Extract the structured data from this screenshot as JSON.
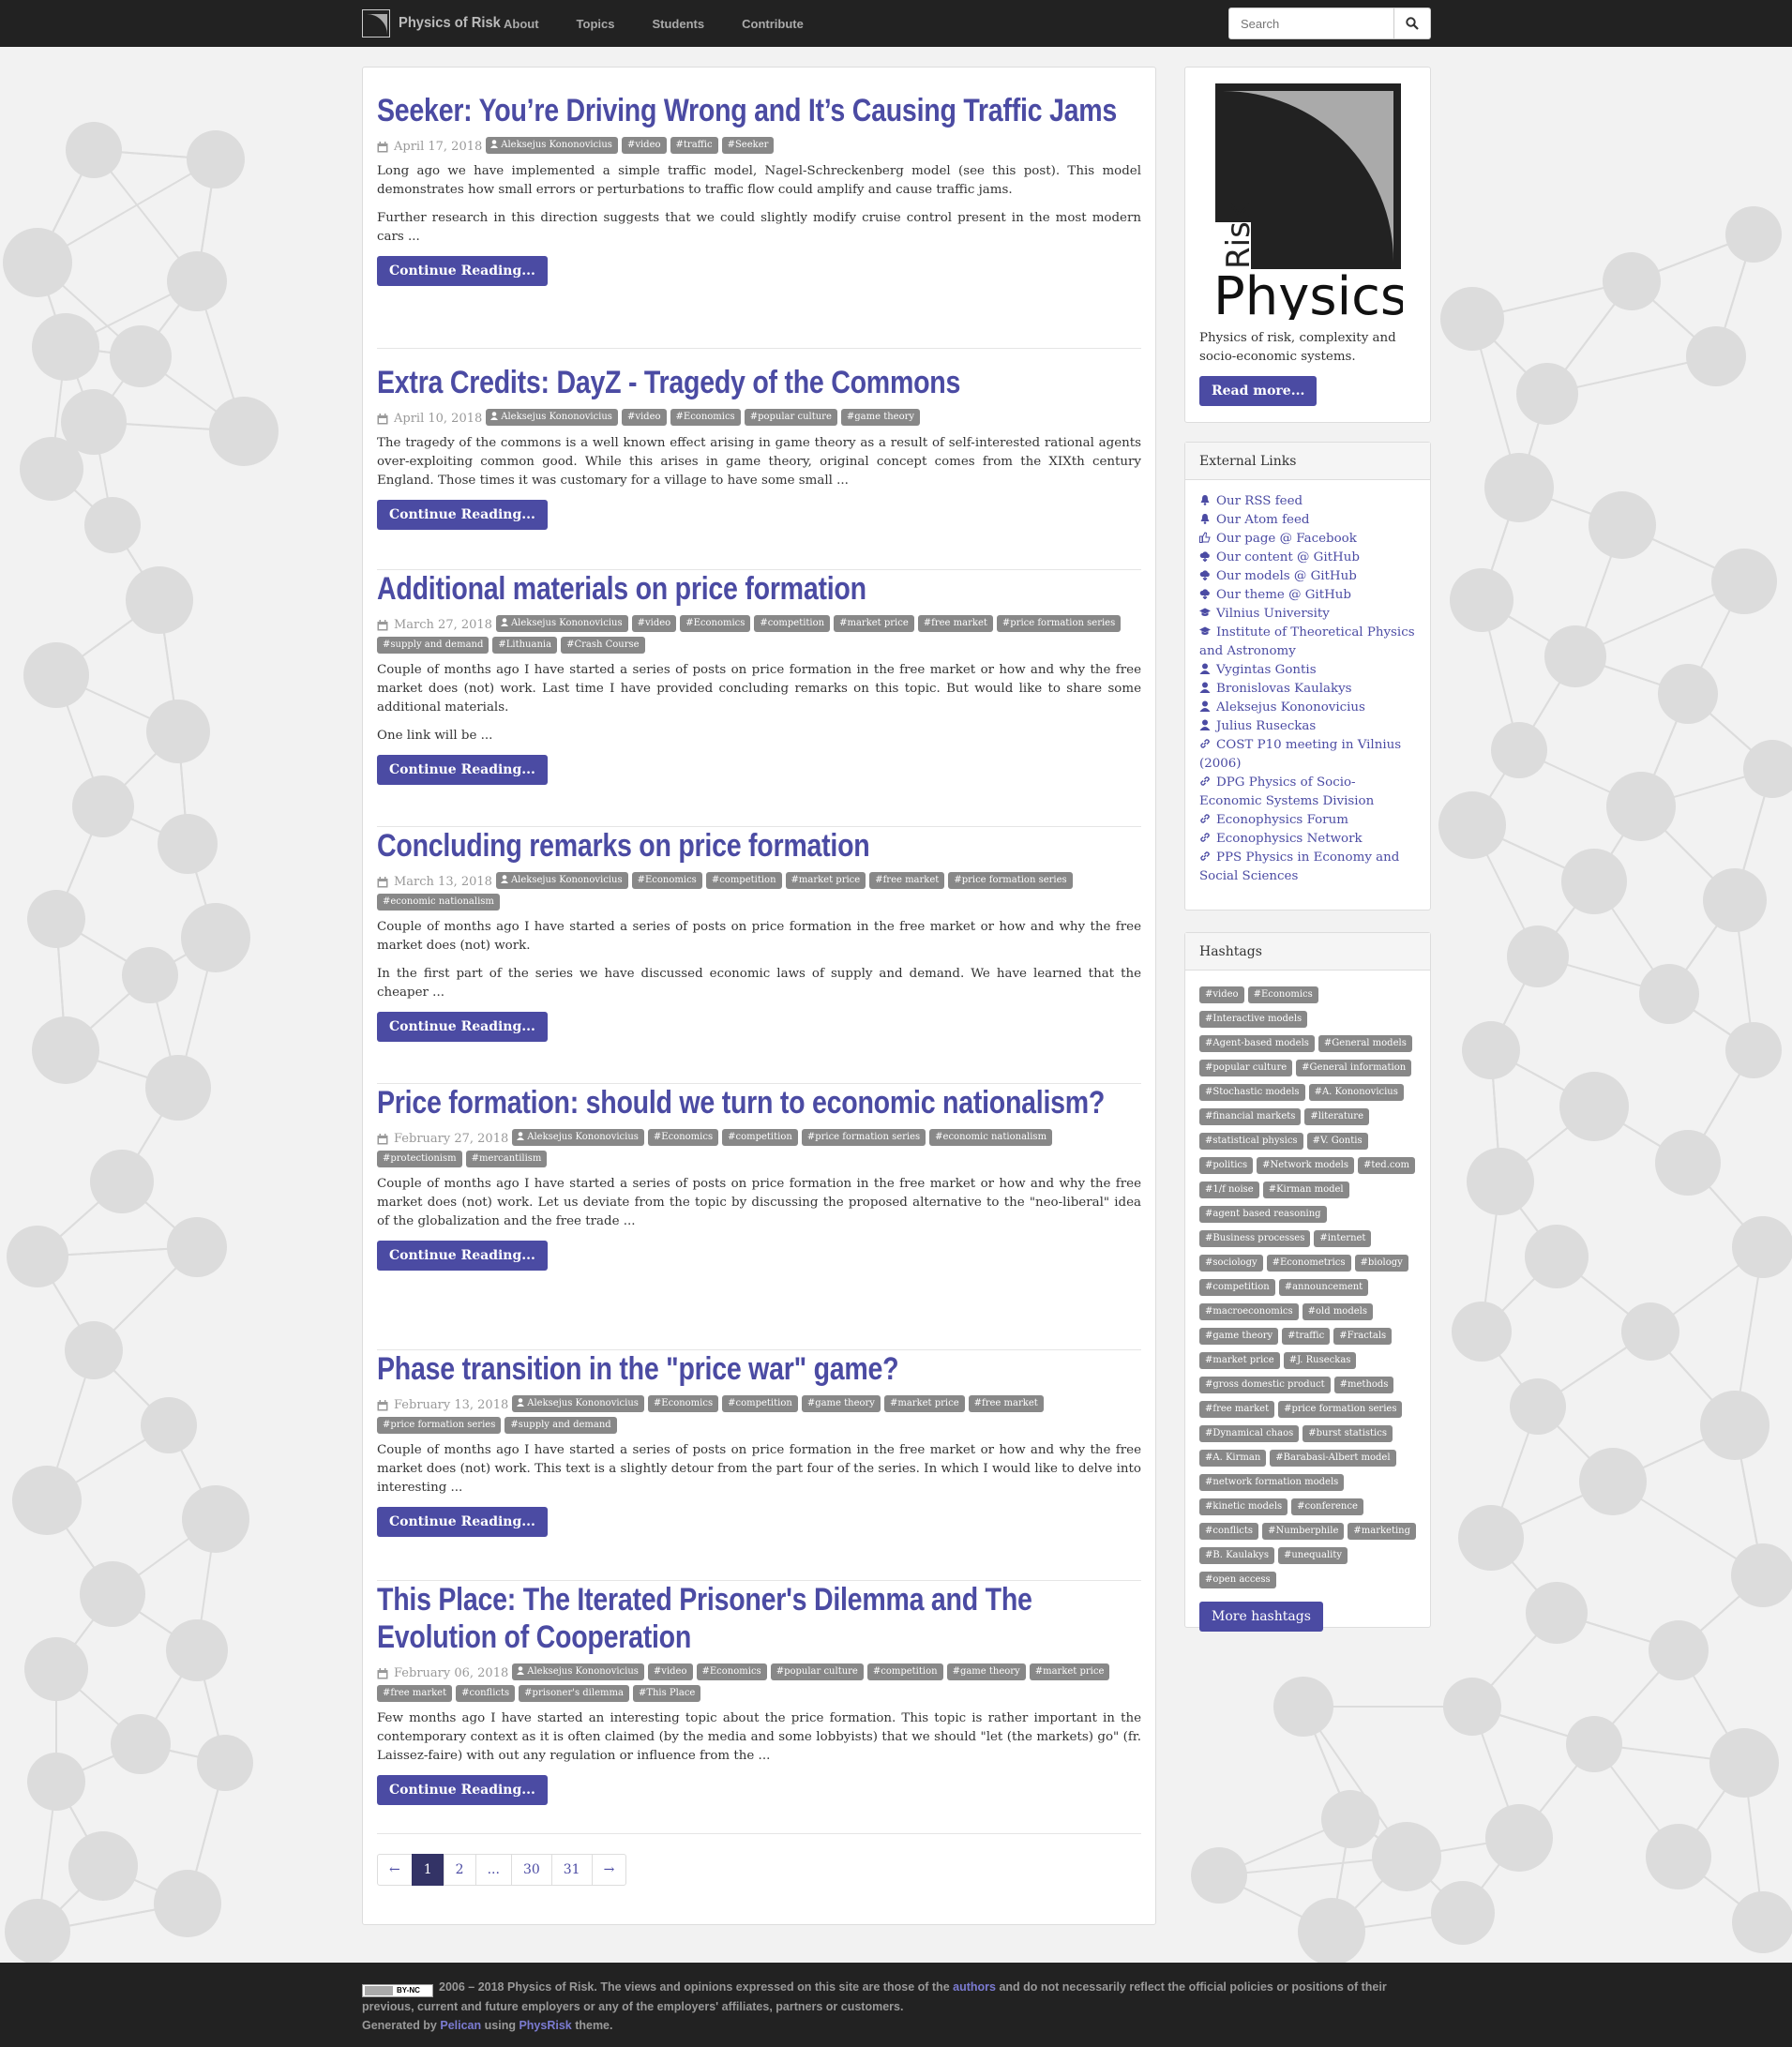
{
  "navbar": {
    "brand": "Physics of Risk",
    "links": [
      "About",
      "Topics",
      "Students",
      "Contribute"
    ],
    "search_placeholder": "Search"
  },
  "posts": [
    {
      "title": "Seeker: You’re Driving Wrong and It’s Causing Traffic Jams",
      "date": "April 17, 2018",
      "author": "Aleksejus Kononovicius",
      "tags": [
        "#video",
        "#traffic",
        "#Seeker"
      ],
      "paragraphs": [
        "Long ago we have implemented a simple traffic model, Nagel-Schreckenberg model (see this post). This model demonstrates how small errors or perturbations to traffic flow could amplify and cause traffic jams.",
        "Further research in this direction suggests that we could slightly modify cruise control present in the most modern cars ..."
      ],
      "button": "Continue Reading..."
    },
    {
      "title": "Extra Credits: DayZ - Tragedy of the Commons",
      "date": "April 10, 2018",
      "author": "Aleksejus Kononovicius",
      "tags": [
        "#video",
        "#Economics",
        "#popular culture",
        "#game theory"
      ],
      "paragraphs": [
        "The tragedy of the commons is a well known effect arising in game theory as a result of self-interested rational agents over-exploiting common good. While this arises in game theory, original concept comes from the XIXth century England. Those times it was customary for a village to have some small ..."
      ],
      "button": "Continue Reading..."
    },
    {
      "title": "Additional materials on price formation",
      "date": "March 27, 2018",
      "author": "Aleksejus Kononovicius",
      "tags": [
        "#video",
        "#Economics",
        "#competition",
        "#market price",
        "#free market",
        "#price formation series",
        "#supply and demand",
        "#Lithuania",
        "#Crash Course"
      ],
      "paragraphs": [
        "Couple of months ago I have started a series of posts on price formation in the free market or how and why the free market does (not) work. Last time I have provided concluding remarks on this topic. But would like to share some additional materials.",
        "One link will be ..."
      ],
      "button": "Continue Reading..."
    },
    {
      "title": "Concluding remarks on price formation",
      "date": "March 13, 2018",
      "author": "Aleksejus Kononovicius",
      "tags": [
        "#Economics",
        "#competition",
        "#market price",
        "#free market",
        "#price formation series",
        "#economic nationalism"
      ],
      "paragraphs": [
        "Couple of months ago I have started a series of posts on price formation in the free market or how and why the free market does (not) work.",
        "In the first part of the series we have discussed economic laws of supply and demand. We have learned that the cheaper ..."
      ],
      "button": "Continue Reading..."
    },
    {
      "title": "Price formation: should we turn to economic nationalism?",
      "date": "February 27, 2018",
      "author": "Aleksejus Kononovicius",
      "tags": [
        "#Economics",
        "#competition",
        "#price formation series",
        "#economic nationalism",
        "#protectionism",
        "#mercantilism"
      ],
      "paragraphs": [
        "Couple of months ago I have started a series of posts on price formation in the free market or how and why the free market does (not) work. Let us deviate from the topic by discussing the proposed alternative to the \"neo-liberal\" idea of the globalization and the free trade ..."
      ],
      "button": "Continue Reading..."
    },
    {
      "title": "Phase transition in the \"price war\" game?",
      "date": "February 13, 2018",
      "author": "Aleksejus Kononovicius",
      "tags": [
        "#Economics",
        "#competition",
        "#game theory",
        "#market price",
        "#free market",
        "#price formation series",
        "#supply and demand"
      ],
      "paragraphs": [
        "Couple of months ago I have started a series of posts on price formation in the free market or how and why the free market does (not) work. This text is a slightly detour from the part four of the series. In which I would like to delve into interesting ..."
      ],
      "button": "Continue Reading..."
    },
    {
      "title": "This Place: The Iterated Prisoner's Dilemma and The Evolution of Cooperation",
      "date": "February 06, 2018",
      "author": "Aleksejus Kononovicius",
      "tags": [
        "#video",
        "#Economics",
        "#popular culture",
        "#competition",
        "#game theory",
        "#market price",
        "#free market",
        "#conflicts",
        "#prisoner's dilemma",
        "#This Place"
      ],
      "paragraphs": [
        "Few months ago I have started an interesting topic about the price formation. This topic is rather important in the contemporary context as it is often claimed (by the media and some lobbyists) that we should \"let (the markets) go\" (fr. Laissez-faire) with out any regulation or influence from the ..."
      ],
      "button": "Continue Reading..."
    }
  ],
  "pagination": [
    "←",
    "1",
    "2",
    "...",
    "30",
    "31",
    "→"
  ],
  "sidebar": {
    "about_text": "Physics of risk, complexity and socio-economic systems.",
    "about_button": "Read more...",
    "logo_word_risk": "Risk",
    "logo_word_physics": "Physics",
    "links_heading": "External Links",
    "links": [
      {
        "icon": "bell-icon",
        "text": "Our RSS feed"
      },
      {
        "icon": "bell-icon",
        "text": "Our Atom feed"
      },
      {
        "icon": "thumbs-up-icon",
        "text": "Our page @ Facebook"
      },
      {
        "icon": "cloud-icon",
        "text": "Our content @ GitHub"
      },
      {
        "icon": "cloud-icon",
        "text": "Our models @ GitHub"
      },
      {
        "icon": "cloud-icon",
        "text": "Our theme @ GitHub"
      },
      {
        "icon": "graduation-cap-icon",
        "text": "Vilnius University"
      },
      {
        "icon": "graduation-cap-icon",
        "text": "Institute of Theoretical Physics and Astronomy"
      },
      {
        "icon": "user-icon",
        "text": "Vygintas Gontis"
      },
      {
        "icon": "user-icon",
        "text": "Bronislovas Kaulakys"
      },
      {
        "icon": "user-icon",
        "text": "Aleksejus Kononovicius"
      },
      {
        "icon": "user-icon",
        "text": "Julius Ruseckas"
      },
      {
        "icon": "link-icon",
        "text": "COST P10 meeting in Vilnius (2006)"
      },
      {
        "icon": "link-icon",
        "text": "DPG Physics of Socio-Economic Systems Division"
      },
      {
        "icon": "link-icon",
        "text": "Econophysics Forum"
      },
      {
        "icon": "link-icon",
        "text": "Econophysics Network"
      },
      {
        "icon": "link-icon",
        "text": "PPS Physics in Economy and Social Sciences"
      }
    ],
    "hashtags_heading": "Hashtags",
    "hashtags": [
      "#video",
      "#Economics",
      "#Interactive models",
      "#Agent-based models",
      "#General models",
      "#popular culture",
      "#General information",
      "#Stochastic models",
      "#A. Kononovicius",
      "#financial markets",
      "#literature",
      "#statistical physics",
      "#V. Gontis",
      "#politics",
      "#Network models",
      "#ted.com",
      "#1/f noise",
      "#Kirman model",
      "#agent based reasoning",
      "#Business processes",
      "#internet",
      "#sociology",
      "#Econometrics",
      "#biology",
      "#competition",
      "#announcement",
      "#macroeconomics",
      "#old models",
      "#game theory",
      "#traffic",
      "#Fractals",
      "#market price",
      "#J. Ruseckas",
      "#gross domestic product",
      "#methods",
      "#free market",
      "#price formation series",
      "#Dynamical chaos",
      "#burst statistics",
      "#A. Kirman",
      "#Barabasi-Albert model",
      "#network formation models",
      "#kinetic models",
      "#conference",
      "#conflicts",
      "#Numberphile",
      "#marketing",
      "#B. Kaulakys",
      "#unequality",
      "#open access"
    ],
    "hashtags_button": "More hashtags"
  },
  "footer": {
    "cc_badge": "BY-NC",
    "line1_a": "2006 – 2018 Physics of Risk. The views and opinions expressed on this site are those of the ",
    "line1_link": "authors",
    "line1_b": " and do not necessarily reflect the official policies or positions of their previous, current and future employers or any of the employers' affiliates, partners or customers.",
    "line2_a": "Generated by ",
    "line2_link1": "Pelican",
    "line2_b": " using ",
    "line2_link2": "PhysRisk",
    "line2_c": " theme."
  }
}
